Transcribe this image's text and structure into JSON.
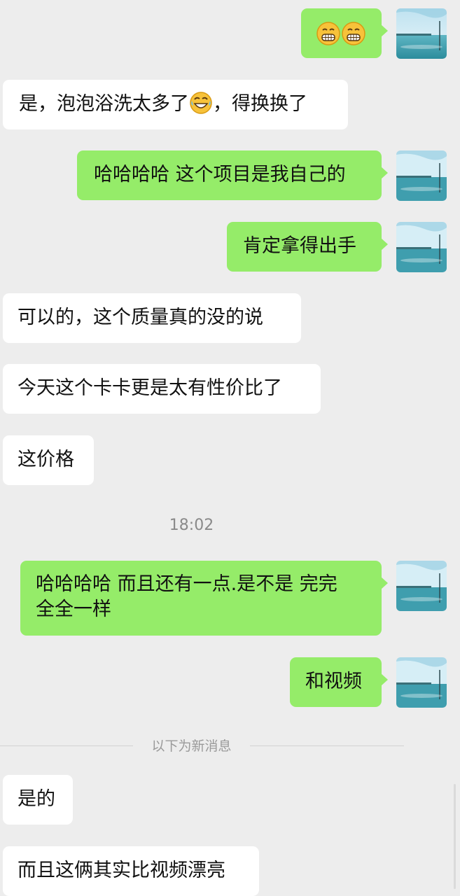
{
  "chat": {
    "messages": [
      {
        "side": "right",
        "text": "",
        "emoji": [
          "grin-emoji",
          "grin-emoji"
        ]
      },
      {
        "side": "left",
        "text_before": "是，泡泡浴洗太多了",
        "emoji": "laugh-tears-emoji",
        "text_after": "，得换换了"
      },
      {
        "side": "right",
        "text": "哈哈哈哈 这个项目是我自己的"
      },
      {
        "side": "right",
        "text": "肯定拿得出手"
      },
      {
        "side": "left",
        "text": "可以的，这个质量真的没的说"
      },
      {
        "side": "left",
        "text": "今天这个卡卡更是太有性价比了"
      },
      {
        "side": "left",
        "text": "这价格"
      },
      {
        "side": "right",
        "text_line1": "哈哈哈哈  而且还有一点.是不是 完完",
        "text_line2": "全全一样"
      },
      {
        "side": "right",
        "text": "和视频"
      },
      {
        "side": "left",
        "text": "是的"
      },
      {
        "side": "left",
        "text": "而且这俩其实比视频漂亮"
      }
    ],
    "timestamp": "18:02",
    "new_messages_divider": "以下为新消息"
  },
  "colors": {
    "background": "#ededed",
    "bubble_self": "#95ec69",
    "bubble_other": "#ffffff",
    "text": "#111111"
  },
  "icons": {
    "avatar": "seascape-avatar-icon"
  }
}
